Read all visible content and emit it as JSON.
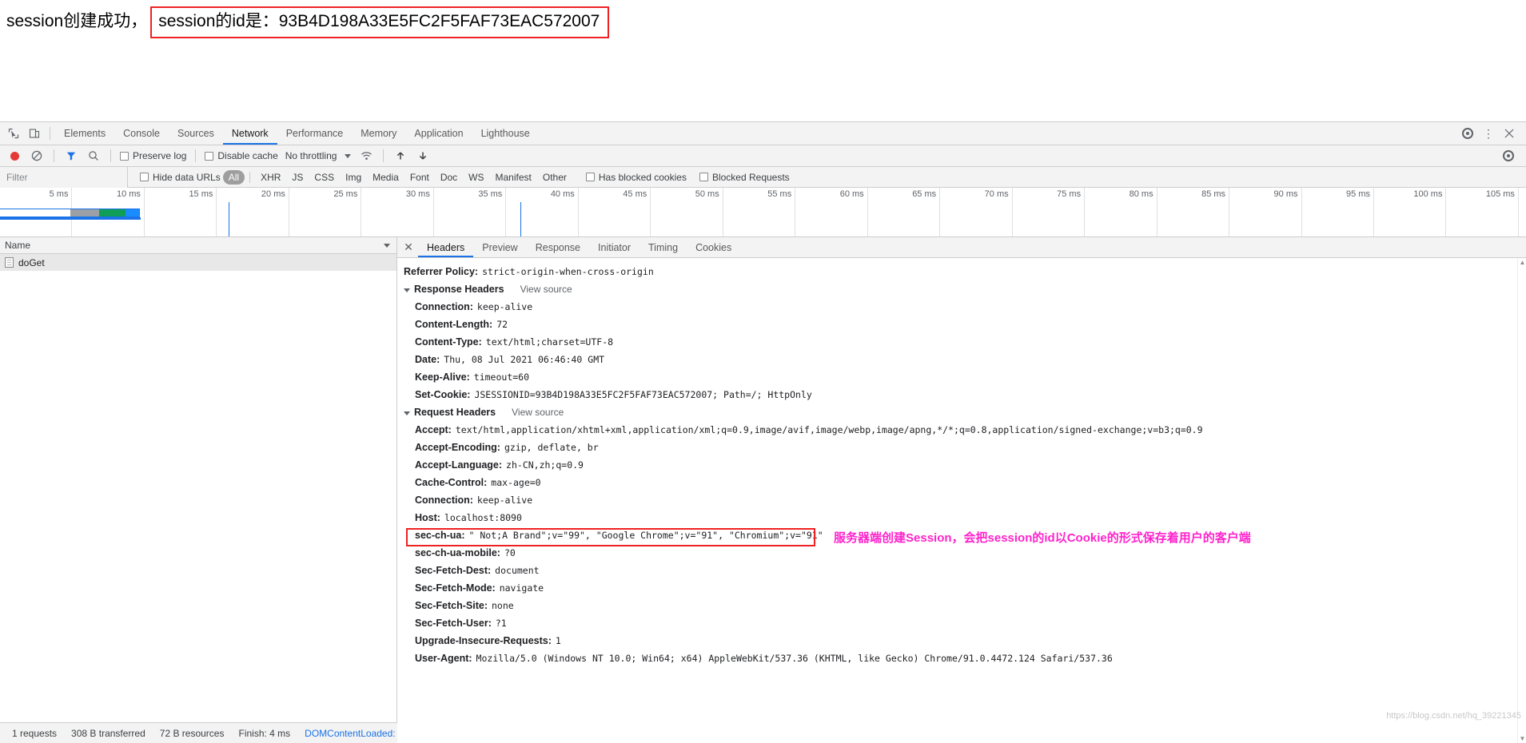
{
  "page": {
    "prefix": "session创建成功，",
    "boxed_text": "session的id是：93B4D198A33E5FC2F5FAF73EAC572007"
  },
  "devtools": {
    "tabs": [
      {
        "label": "Elements",
        "active": false
      },
      {
        "label": "Console",
        "active": false
      },
      {
        "label": "Sources",
        "active": false
      },
      {
        "label": "Network",
        "active": true
      },
      {
        "label": "Performance",
        "active": false
      },
      {
        "label": "Memory",
        "active": false
      },
      {
        "label": "Application",
        "active": false
      },
      {
        "label": "Lighthouse",
        "active": false
      }
    ],
    "controls": {
      "preserve_log": "Preserve log",
      "disable_cache": "Disable cache",
      "throttling": "No throttling"
    },
    "filterbar": {
      "filter_placeholder": "Filter",
      "hide_data_urls": "Hide data URLs",
      "types": [
        "All",
        "XHR",
        "JS",
        "CSS",
        "Img",
        "Media",
        "Font",
        "Doc",
        "WS",
        "Manifest",
        "Other"
      ],
      "selected_type": "All",
      "has_blocked_cookies": "Has blocked cookies",
      "blocked_requests": "Blocked Requests"
    },
    "timeline": {
      "ticks": [
        "5 ms",
        "10 ms",
        "15 ms",
        "20 ms",
        "25 ms",
        "30 ms",
        "35 ms",
        "40 ms",
        "45 ms",
        "50 ms",
        "55 ms",
        "60 ms",
        "65 ms",
        "70 ms",
        "75 ms",
        "80 ms",
        "85 ms",
        "90 ms",
        "95 ms",
        "100 ms",
        "105 ms"
      ]
    },
    "requests": {
      "column_header": "Name",
      "rows": [
        {
          "name": "doGet"
        }
      ]
    },
    "detail": {
      "tabs": [
        {
          "label": "Headers",
          "active": true
        },
        {
          "label": "Preview",
          "active": false
        },
        {
          "label": "Response",
          "active": false
        },
        {
          "label": "Initiator",
          "active": false
        },
        {
          "label": "Timing",
          "active": false
        },
        {
          "label": "Cookies",
          "active": false
        }
      ],
      "referrer_policy_key": "Referrer Policy:",
      "referrer_policy_value": "strict-origin-when-cross-origin",
      "view_source": "View source",
      "response_headers_title": "Response Headers",
      "response_headers": [
        {
          "key": "Connection:",
          "value": "keep-alive"
        },
        {
          "key": "Content-Length:",
          "value": "72"
        },
        {
          "key": "Content-Type:",
          "value": "text/html;charset=UTF-8"
        },
        {
          "key": "Date:",
          "value": "Thu, 08 Jul 2021 06:46:40 GMT"
        },
        {
          "key": "Keep-Alive:",
          "value": "timeout=60"
        },
        {
          "key": "Set-Cookie:",
          "value": "JSESSIONID=93B4D198A33E5FC2F5FAF73EAC572007; Path=/; HttpOnly"
        }
      ],
      "request_headers_title": "Request Headers",
      "request_headers": [
        {
          "key": "Accept:",
          "value": "text/html,application/xhtml+xml,application/xml;q=0.9,image/avif,image/webp,image/apng,*/*;q=0.8,application/signed-exchange;v=b3;q=0.9"
        },
        {
          "key": "Accept-Encoding:",
          "value": "gzip, deflate, br"
        },
        {
          "key": "Accept-Language:",
          "value": "zh-CN,zh;q=0.9"
        },
        {
          "key": "Cache-Control:",
          "value": "max-age=0"
        },
        {
          "key": "Connection:",
          "value": "keep-alive"
        },
        {
          "key": "Host:",
          "value": "localhost:8090"
        },
        {
          "key": "sec-ch-ua:",
          "value": "\" Not;A Brand\";v=\"99\", \"Google Chrome\";v=\"91\", \"Chromium\";v=\"91\""
        },
        {
          "key": "sec-ch-ua-mobile:",
          "value": "?0"
        },
        {
          "key": "Sec-Fetch-Dest:",
          "value": "document"
        },
        {
          "key": "Sec-Fetch-Mode:",
          "value": "navigate"
        },
        {
          "key": "Sec-Fetch-Site:",
          "value": "none"
        },
        {
          "key": "Sec-Fetch-User:",
          "value": "?1"
        },
        {
          "key": "Upgrade-Insecure-Requests:",
          "value": "1"
        },
        {
          "key": "User-Agent:",
          "value": "Mozilla/5.0 (Windows NT 10.0; Win64; x64) AppleWebKit/537.36 (KHTML, like Gecko) Chrome/91.0.4472.124 Safari/537.36"
        }
      ],
      "annotation": "服务器端创建Session，会把session的id以Cookie的形式保存着用户的客户端"
    },
    "status": {
      "requests": "1 requests",
      "transferred": "308 B transferred",
      "resources": "72 B resources",
      "finish": "Finish: 4 ms",
      "domcontentloaded": "DOMContentLoaded:"
    },
    "watermark": "https://blog.csdn.net/hq_39221345",
    "colors": {
      "accent": "#1a73e8",
      "record": "#e53935",
      "annotation": "#ff22cc",
      "highlight_box": "#ee2222",
      "wf_green": "#0f9d58",
      "wf_gray": "#9aa0a6",
      "wf_blue": "#1a8cff"
    }
  }
}
